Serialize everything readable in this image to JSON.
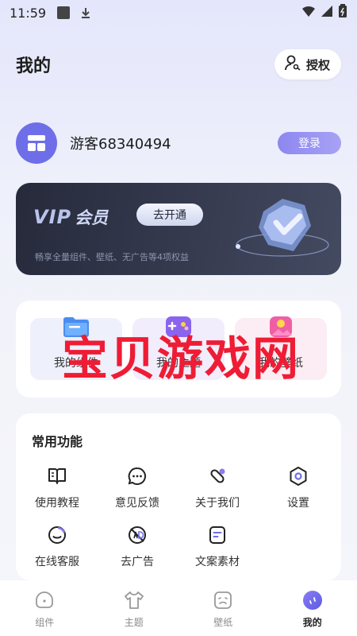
{
  "status_bar": {
    "time": "11:59"
  },
  "header": {
    "title": "我的",
    "auth_label": "授权"
  },
  "user": {
    "name": "游客68340494",
    "login_label": "登录"
  },
  "vip": {
    "logo_text": "VIP",
    "logo_suffix": "会员",
    "open_label": "去开通",
    "description": "畅享全量组件、壁纸、无广告等4项权益"
  },
  "mine": {
    "items": [
      {
        "label": "我的组件",
        "icon": "folder-icon"
      },
      {
        "label": "我的主题",
        "icon": "gamepad-icon"
      },
      {
        "label": "我的壁纸",
        "icon": "image-icon"
      }
    ]
  },
  "watermark": {
    "text": "宝贝游戏网"
  },
  "functions": {
    "title": "常用功能",
    "items": [
      {
        "label": "使用教程",
        "icon": "book-icon"
      },
      {
        "label": "意见反馈",
        "icon": "chat-icon"
      },
      {
        "label": "关于我们",
        "icon": "link-icon"
      },
      {
        "label": "设置",
        "icon": "settings-icon"
      },
      {
        "label": "在线客服",
        "icon": "smile-icon"
      },
      {
        "label": "去广告",
        "icon": "no-ad-icon"
      },
      {
        "label": "文案素材",
        "icon": "document-icon"
      }
    ]
  },
  "tabs": [
    {
      "label": "组件",
      "icon": "widget-icon",
      "active": false
    },
    {
      "label": "主题",
      "icon": "shirt-icon",
      "active": false
    },
    {
      "label": "壁纸",
      "icon": "wallpaper-icon",
      "active": false
    },
    {
      "label": "我的",
      "icon": "profile-icon",
      "active": true
    }
  ],
  "colors": {
    "accent": "#6e6fe8",
    "vip_bg": "#2c3044",
    "watermark": "#ee1c34"
  }
}
